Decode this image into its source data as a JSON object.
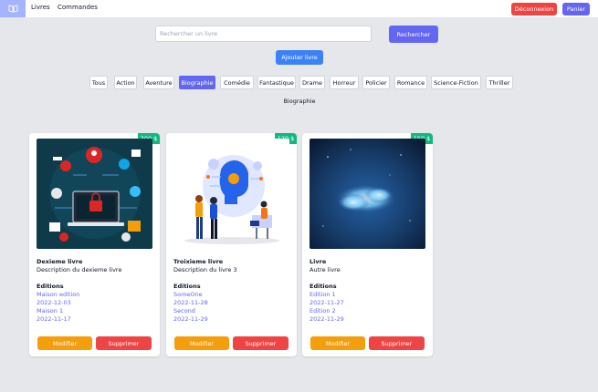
{
  "nav": {
    "brand_icon": "book-icon",
    "links": [
      "Livres",
      "Commandes"
    ],
    "logout_label": "Déconnexion",
    "cart_label": "Panier"
  },
  "search": {
    "placeholder": "Rechercher un livre",
    "value": "",
    "button_label": "Rechercher"
  },
  "add_label": "Ajouter livre",
  "categories": [
    "Tous",
    "Action",
    "Aventure",
    "Biographie",
    "Comédie",
    "Fantastique",
    "Drame",
    "Horreur",
    "Policier",
    "Romance",
    "Science-Fiction",
    "Thriller"
  ],
  "active_category": "Biographie",
  "selected_category_label": "Biographie",
  "colors": {
    "primary": "#6366f1",
    "danger": "#ef4444",
    "blue": "#3b82f6",
    "price": "#10b981",
    "warning": "#f59e0b"
  },
  "cards": [
    {
      "price": "200 $",
      "image": "cybersecurity-illustration",
      "title": "Dexieme livre",
      "description": "Description du dexieme livre",
      "editions_label": "Editions",
      "editions": [
        "Maison edition",
        "2022-12-03",
        "Maison 1",
        "2022-11-17"
      ],
      "modify_label": "Modifier",
      "delete_label": "Supprimer"
    },
    {
      "price": "120 $",
      "image": "ai-team-illustration",
      "title": "Troixieme livre",
      "description": "Description du livre 3",
      "editions_label": "Editions",
      "editions": [
        "SomeOne",
        "2022-11-28",
        "Second",
        "2022-11-29"
      ],
      "modify_label": "Modifier",
      "delete_label": "Supprimer"
    },
    {
      "price": "150 $",
      "image": "night-sky-cloud-photo",
      "title": "Livre",
      "description": "Autre livre",
      "editions_label": "Editions",
      "editions": [
        "Edition 1",
        "2022-11-27",
        "Edition 2",
        "2022-11-29"
      ],
      "modify_label": "Modifier",
      "delete_label": "Supprimer"
    }
  ]
}
